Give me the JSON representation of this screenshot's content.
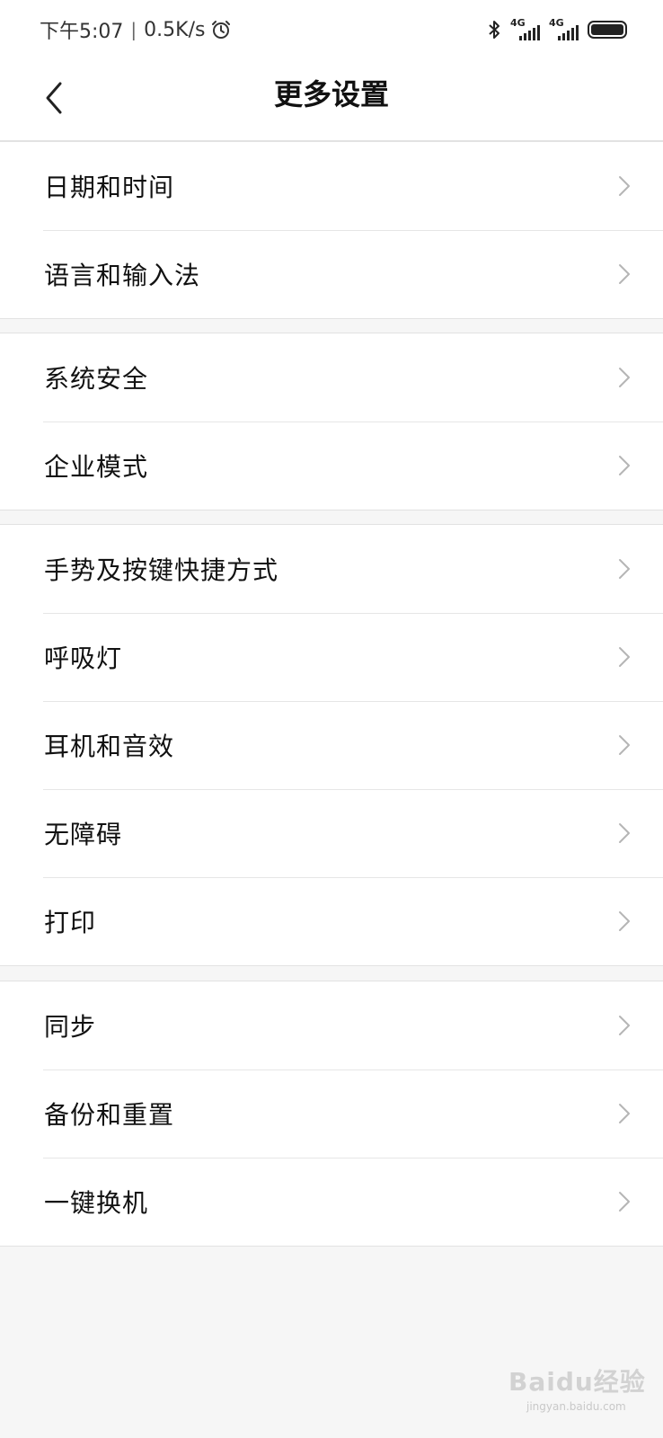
{
  "status_bar": {
    "time": "下午5:07",
    "separator": "|",
    "network_speed": "0.5K/s",
    "alarm_icon": "alarm-icon",
    "bluetooth_icon": "bluetooth-icon",
    "sim1_label": "4G",
    "sim2_label": "4G",
    "battery_icon": "battery-icon"
  },
  "header": {
    "back_icon": "chevron-left-icon",
    "title": "更多设置"
  },
  "groups": [
    {
      "items": [
        {
          "label": "日期和时间"
        },
        {
          "label": "语言和输入法"
        }
      ]
    },
    {
      "items": [
        {
          "label": "系统安全"
        },
        {
          "label": "企业模式"
        }
      ]
    },
    {
      "items": [
        {
          "label": "手势及按键快捷方式"
        },
        {
          "label": "呼吸灯"
        },
        {
          "label": "耳机和音效"
        },
        {
          "label": "无障碍"
        },
        {
          "label": "打印"
        }
      ]
    },
    {
      "items": [
        {
          "label": "同步"
        },
        {
          "label": "备份和重置"
        },
        {
          "label": "一键换机"
        }
      ]
    }
  ],
  "watermark": {
    "brand": "Baidu经验",
    "url": "jingyan.baidu.com"
  }
}
